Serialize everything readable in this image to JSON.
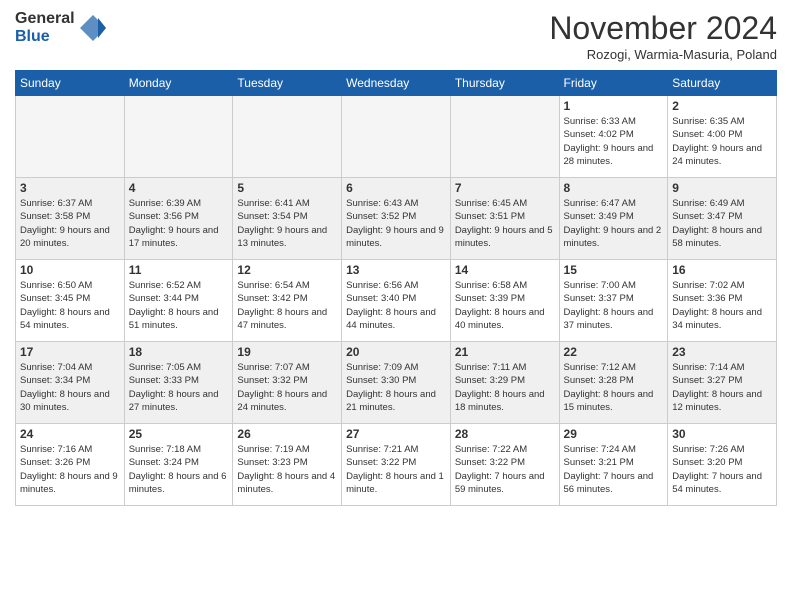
{
  "logo": {
    "general": "General",
    "blue": "Blue"
  },
  "title": "November 2024",
  "location": "Rozogi, Warmia-Masuria, Poland",
  "days_header": [
    "Sunday",
    "Monday",
    "Tuesday",
    "Wednesday",
    "Thursday",
    "Friday",
    "Saturday"
  ],
  "weeks": [
    [
      {
        "day": "",
        "info": "",
        "empty": true
      },
      {
        "day": "",
        "info": "",
        "empty": true
      },
      {
        "day": "",
        "info": "",
        "empty": true
      },
      {
        "day": "",
        "info": "",
        "empty": true
      },
      {
        "day": "",
        "info": "",
        "empty": true
      },
      {
        "day": "1",
        "info": "Sunrise: 6:33 AM\nSunset: 4:02 PM\nDaylight: 9 hours and 28 minutes."
      },
      {
        "day": "2",
        "info": "Sunrise: 6:35 AM\nSunset: 4:00 PM\nDaylight: 9 hours and 24 minutes."
      }
    ],
    [
      {
        "day": "3",
        "info": "Sunrise: 6:37 AM\nSunset: 3:58 PM\nDaylight: 9 hours and 20 minutes."
      },
      {
        "day": "4",
        "info": "Sunrise: 6:39 AM\nSunset: 3:56 PM\nDaylight: 9 hours and 17 minutes."
      },
      {
        "day": "5",
        "info": "Sunrise: 6:41 AM\nSunset: 3:54 PM\nDaylight: 9 hours and 13 minutes."
      },
      {
        "day": "6",
        "info": "Sunrise: 6:43 AM\nSunset: 3:52 PM\nDaylight: 9 hours and 9 minutes."
      },
      {
        "day": "7",
        "info": "Sunrise: 6:45 AM\nSunset: 3:51 PM\nDaylight: 9 hours and 5 minutes."
      },
      {
        "day": "8",
        "info": "Sunrise: 6:47 AM\nSunset: 3:49 PM\nDaylight: 9 hours and 2 minutes."
      },
      {
        "day": "9",
        "info": "Sunrise: 6:49 AM\nSunset: 3:47 PM\nDaylight: 8 hours and 58 minutes."
      }
    ],
    [
      {
        "day": "10",
        "info": "Sunrise: 6:50 AM\nSunset: 3:45 PM\nDaylight: 8 hours and 54 minutes."
      },
      {
        "day": "11",
        "info": "Sunrise: 6:52 AM\nSunset: 3:44 PM\nDaylight: 8 hours and 51 minutes."
      },
      {
        "day": "12",
        "info": "Sunrise: 6:54 AM\nSunset: 3:42 PM\nDaylight: 8 hours and 47 minutes."
      },
      {
        "day": "13",
        "info": "Sunrise: 6:56 AM\nSunset: 3:40 PM\nDaylight: 8 hours and 44 minutes."
      },
      {
        "day": "14",
        "info": "Sunrise: 6:58 AM\nSunset: 3:39 PM\nDaylight: 8 hours and 40 minutes."
      },
      {
        "day": "15",
        "info": "Sunrise: 7:00 AM\nSunset: 3:37 PM\nDaylight: 8 hours and 37 minutes."
      },
      {
        "day": "16",
        "info": "Sunrise: 7:02 AM\nSunset: 3:36 PM\nDaylight: 8 hours and 34 minutes."
      }
    ],
    [
      {
        "day": "17",
        "info": "Sunrise: 7:04 AM\nSunset: 3:34 PM\nDaylight: 8 hours and 30 minutes."
      },
      {
        "day": "18",
        "info": "Sunrise: 7:05 AM\nSunset: 3:33 PM\nDaylight: 8 hours and 27 minutes."
      },
      {
        "day": "19",
        "info": "Sunrise: 7:07 AM\nSunset: 3:32 PM\nDaylight: 8 hours and 24 minutes."
      },
      {
        "day": "20",
        "info": "Sunrise: 7:09 AM\nSunset: 3:30 PM\nDaylight: 8 hours and 21 minutes."
      },
      {
        "day": "21",
        "info": "Sunrise: 7:11 AM\nSunset: 3:29 PM\nDaylight: 8 hours and 18 minutes."
      },
      {
        "day": "22",
        "info": "Sunrise: 7:12 AM\nSunset: 3:28 PM\nDaylight: 8 hours and 15 minutes."
      },
      {
        "day": "23",
        "info": "Sunrise: 7:14 AM\nSunset: 3:27 PM\nDaylight: 8 hours and 12 minutes."
      }
    ],
    [
      {
        "day": "24",
        "info": "Sunrise: 7:16 AM\nSunset: 3:26 PM\nDaylight: 8 hours and 9 minutes."
      },
      {
        "day": "25",
        "info": "Sunrise: 7:18 AM\nSunset: 3:24 PM\nDaylight: 8 hours and 6 minutes."
      },
      {
        "day": "26",
        "info": "Sunrise: 7:19 AM\nSunset: 3:23 PM\nDaylight: 8 hours and 4 minutes."
      },
      {
        "day": "27",
        "info": "Sunrise: 7:21 AM\nSunset: 3:22 PM\nDaylight: 8 hours and 1 minute."
      },
      {
        "day": "28",
        "info": "Sunrise: 7:22 AM\nSunset: 3:22 PM\nDaylight: 7 hours and 59 minutes."
      },
      {
        "day": "29",
        "info": "Sunrise: 7:24 AM\nSunset: 3:21 PM\nDaylight: 7 hours and 56 minutes."
      },
      {
        "day": "30",
        "info": "Sunrise: 7:26 AM\nSunset: 3:20 PM\nDaylight: 7 hours and 54 minutes."
      }
    ]
  ]
}
